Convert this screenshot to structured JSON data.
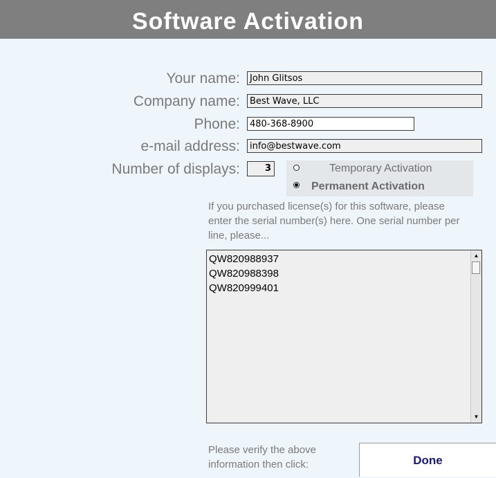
{
  "title": "Software Activation",
  "form": {
    "name_label": "Your name:",
    "name_value": "John Glitsos",
    "company_label": "Company name:",
    "company_value": "Best Wave, LLC",
    "phone_label": "Phone:",
    "phone_value": "480-368-8900",
    "email_label": "e-mail address:",
    "email_value": "info@bestwave.com",
    "displays_label": "Number of displays:",
    "displays_value": "3"
  },
  "activation": {
    "temporary_label": "Temporary Activation",
    "permanent_label": "Permanent Activation",
    "selected": "permanent"
  },
  "instructions": "If you purchased license(s) for this software, please enter the serial number(s) here. One serial number per line, please...",
  "serials": [
    "QW820988937",
    "QW820988398",
    "QW820999401"
  ],
  "footer": {
    "verify_text": "Please verify the above information then click:",
    "done_label": "Done"
  },
  "icons": {
    "scroll_up": "scroll-up-arrow-icon",
    "scroll_down": "scroll-down-arrow-icon"
  }
}
